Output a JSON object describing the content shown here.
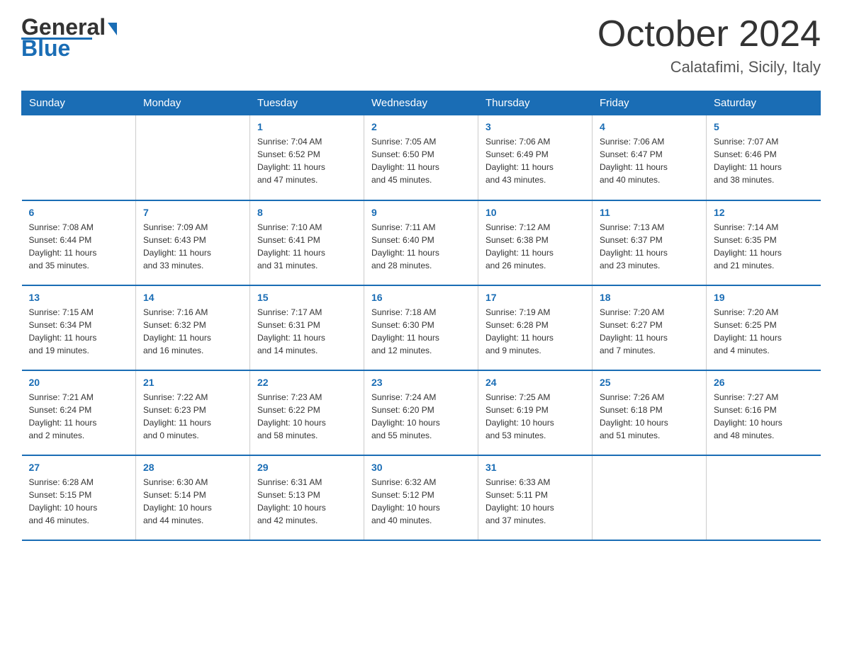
{
  "header": {
    "logo_general": "General",
    "logo_blue": "Blue",
    "month_title": "October 2024",
    "location": "Calatafimi, Sicily, Italy"
  },
  "weekdays": [
    "Sunday",
    "Monday",
    "Tuesday",
    "Wednesday",
    "Thursday",
    "Friday",
    "Saturday"
  ],
  "weeks": [
    [
      {
        "day": "",
        "info": ""
      },
      {
        "day": "",
        "info": ""
      },
      {
        "day": "1",
        "info": "Sunrise: 7:04 AM\nSunset: 6:52 PM\nDaylight: 11 hours\nand 47 minutes."
      },
      {
        "day": "2",
        "info": "Sunrise: 7:05 AM\nSunset: 6:50 PM\nDaylight: 11 hours\nand 45 minutes."
      },
      {
        "day": "3",
        "info": "Sunrise: 7:06 AM\nSunset: 6:49 PM\nDaylight: 11 hours\nand 43 minutes."
      },
      {
        "day": "4",
        "info": "Sunrise: 7:06 AM\nSunset: 6:47 PM\nDaylight: 11 hours\nand 40 minutes."
      },
      {
        "day": "5",
        "info": "Sunrise: 7:07 AM\nSunset: 6:46 PM\nDaylight: 11 hours\nand 38 minutes."
      }
    ],
    [
      {
        "day": "6",
        "info": "Sunrise: 7:08 AM\nSunset: 6:44 PM\nDaylight: 11 hours\nand 35 minutes."
      },
      {
        "day": "7",
        "info": "Sunrise: 7:09 AM\nSunset: 6:43 PM\nDaylight: 11 hours\nand 33 minutes."
      },
      {
        "day": "8",
        "info": "Sunrise: 7:10 AM\nSunset: 6:41 PM\nDaylight: 11 hours\nand 31 minutes."
      },
      {
        "day": "9",
        "info": "Sunrise: 7:11 AM\nSunset: 6:40 PM\nDaylight: 11 hours\nand 28 minutes."
      },
      {
        "day": "10",
        "info": "Sunrise: 7:12 AM\nSunset: 6:38 PM\nDaylight: 11 hours\nand 26 minutes."
      },
      {
        "day": "11",
        "info": "Sunrise: 7:13 AM\nSunset: 6:37 PM\nDaylight: 11 hours\nand 23 minutes."
      },
      {
        "day": "12",
        "info": "Sunrise: 7:14 AM\nSunset: 6:35 PM\nDaylight: 11 hours\nand 21 minutes."
      }
    ],
    [
      {
        "day": "13",
        "info": "Sunrise: 7:15 AM\nSunset: 6:34 PM\nDaylight: 11 hours\nand 19 minutes."
      },
      {
        "day": "14",
        "info": "Sunrise: 7:16 AM\nSunset: 6:32 PM\nDaylight: 11 hours\nand 16 minutes."
      },
      {
        "day": "15",
        "info": "Sunrise: 7:17 AM\nSunset: 6:31 PM\nDaylight: 11 hours\nand 14 minutes."
      },
      {
        "day": "16",
        "info": "Sunrise: 7:18 AM\nSunset: 6:30 PM\nDaylight: 11 hours\nand 12 minutes."
      },
      {
        "day": "17",
        "info": "Sunrise: 7:19 AM\nSunset: 6:28 PM\nDaylight: 11 hours\nand 9 minutes."
      },
      {
        "day": "18",
        "info": "Sunrise: 7:20 AM\nSunset: 6:27 PM\nDaylight: 11 hours\nand 7 minutes."
      },
      {
        "day": "19",
        "info": "Sunrise: 7:20 AM\nSunset: 6:25 PM\nDaylight: 11 hours\nand 4 minutes."
      }
    ],
    [
      {
        "day": "20",
        "info": "Sunrise: 7:21 AM\nSunset: 6:24 PM\nDaylight: 11 hours\nand 2 minutes."
      },
      {
        "day": "21",
        "info": "Sunrise: 7:22 AM\nSunset: 6:23 PM\nDaylight: 11 hours\nand 0 minutes."
      },
      {
        "day": "22",
        "info": "Sunrise: 7:23 AM\nSunset: 6:22 PM\nDaylight: 10 hours\nand 58 minutes."
      },
      {
        "day": "23",
        "info": "Sunrise: 7:24 AM\nSunset: 6:20 PM\nDaylight: 10 hours\nand 55 minutes."
      },
      {
        "day": "24",
        "info": "Sunrise: 7:25 AM\nSunset: 6:19 PM\nDaylight: 10 hours\nand 53 minutes."
      },
      {
        "day": "25",
        "info": "Sunrise: 7:26 AM\nSunset: 6:18 PM\nDaylight: 10 hours\nand 51 minutes."
      },
      {
        "day": "26",
        "info": "Sunrise: 7:27 AM\nSunset: 6:16 PM\nDaylight: 10 hours\nand 48 minutes."
      }
    ],
    [
      {
        "day": "27",
        "info": "Sunrise: 6:28 AM\nSunset: 5:15 PM\nDaylight: 10 hours\nand 46 minutes."
      },
      {
        "day": "28",
        "info": "Sunrise: 6:30 AM\nSunset: 5:14 PM\nDaylight: 10 hours\nand 44 minutes."
      },
      {
        "day": "29",
        "info": "Sunrise: 6:31 AM\nSunset: 5:13 PM\nDaylight: 10 hours\nand 42 minutes."
      },
      {
        "day": "30",
        "info": "Sunrise: 6:32 AM\nSunset: 5:12 PM\nDaylight: 10 hours\nand 40 minutes."
      },
      {
        "day": "31",
        "info": "Sunrise: 6:33 AM\nSunset: 5:11 PM\nDaylight: 10 hours\nand 37 minutes."
      },
      {
        "day": "",
        "info": ""
      },
      {
        "day": "",
        "info": ""
      }
    ]
  ]
}
